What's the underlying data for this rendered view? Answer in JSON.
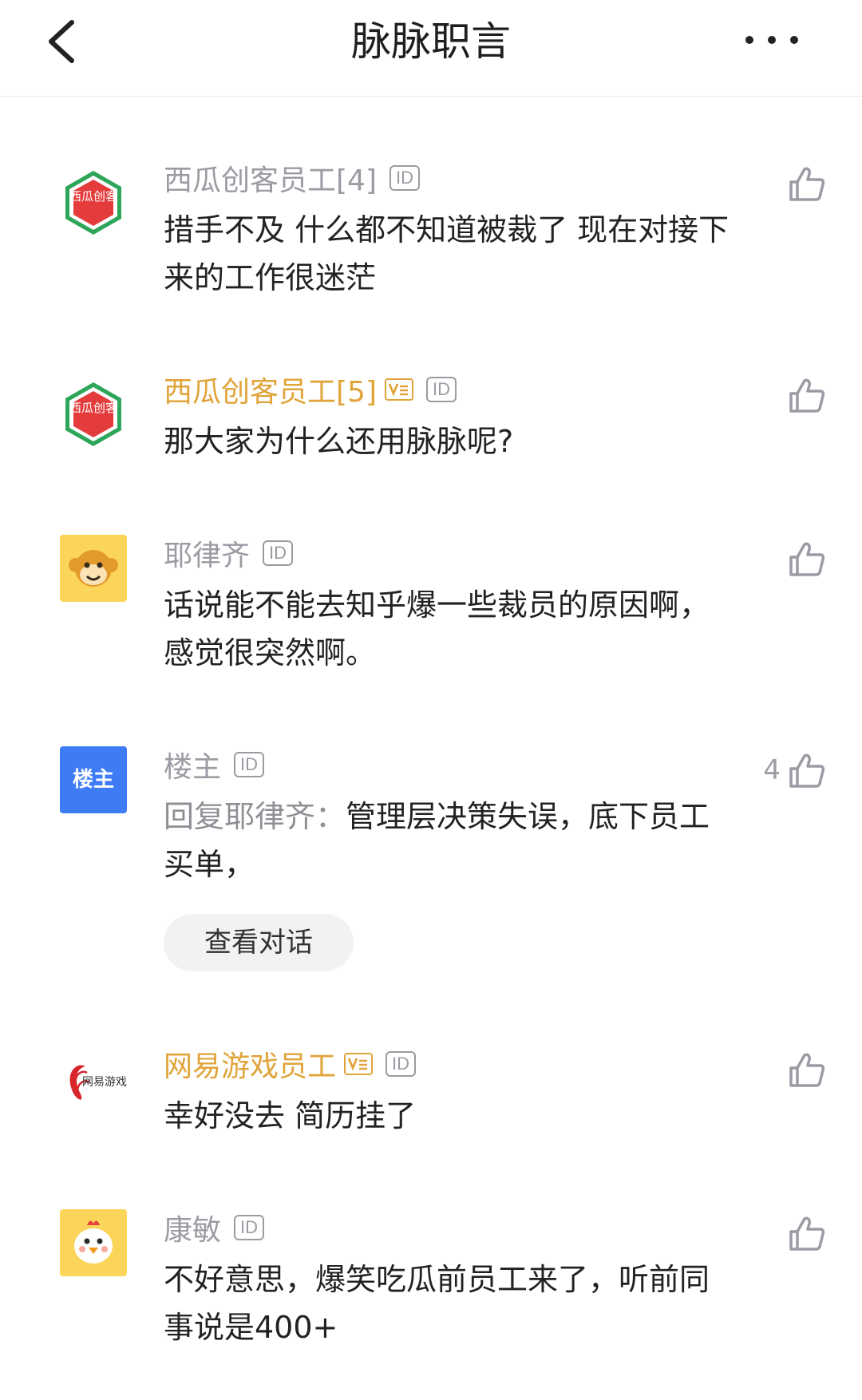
{
  "header": {
    "title": "脉脉职言"
  },
  "comments": [
    {
      "name": "西瓜创客员工[4]",
      "id_badge": "ID",
      "text": "措手不及 什么都不知道被裁了 现在对接下来的工作很迷茫",
      "likes": "",
      "avatar_text": "西瓜创客"
    },
    {
      "name": "西瓜创客员工[5]",
      "id_badge": "ID",
      "text": "那大家为什么还用脉脉呢?",
      "likes": "",
      "avatar_text": "西瓜创客"
    },
    {
      "name": "耶律齐",
      "id_badge": "ID",
      "text": "话说能不能去知乎爆一些裁员的原因啊，感觉很突然啊。",
      "likes": ""
    },
    {
      "name": "楼主",
      "id_badge": "ID",
      "reply_prefix": "回复耶律齐：",
      "text": "管理层决策失误，底下员工买单，",
      "likes": "4",
      "avatar_text": "楼主",
      "view_label": "查看对话"
    },
    {
      "name": "网易游戏员工",
      "id_badge": "ID",
      "text": "幸好没去 简历挂了",
      "likes": "",
      "avatar_text": "网易游戏"
    },
    {
      "name": "康敏",
      "id_badge": "ID",
      "text": "不好意思，爆笑吃瓜前员工来了，听前同事说是400+",
      "likes": ""
    }
  ],
  "colors": {
    "gold": "#e0a43a",
    "gray": "#9b9ba3",
    "blue": "#3e7cf5"
  },
  "icons": [
    "back-arrow-icon",
    "more-dots-icon",
    "thumb-up-icon",
    "verified-v-icon"
  ]
}
